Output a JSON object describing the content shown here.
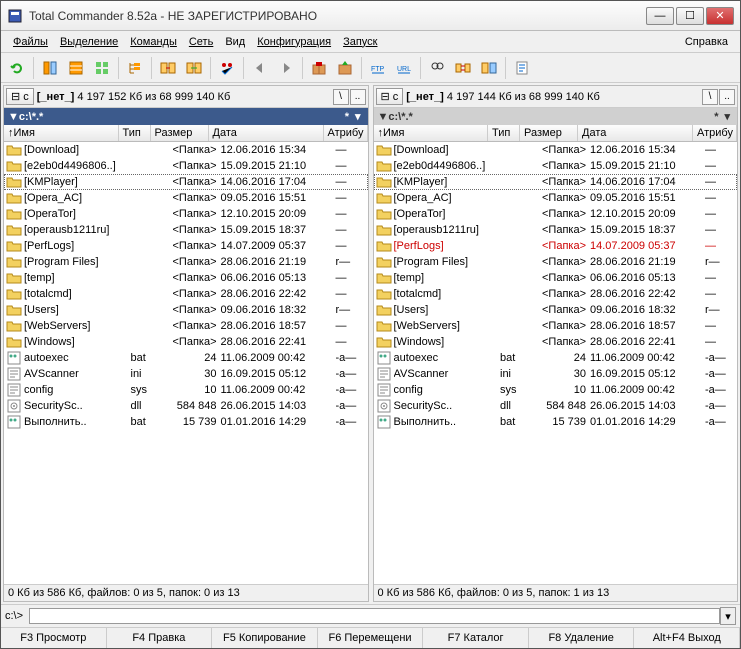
{
  "title": "Total Commander 8.52a - НЕ ЗАРЕГИСТРИРОВАНО",
  "menu": {
    "files": "Файлы",
    "selection": "Выделение",
    "commands": "Команды",
    "net": "Сеть",
    "view": "Вид",
    "config": "Конфигурация",
    "run": "Запуск",
    "help": "Справка"
  },
  "drive": {
    "letter": "c",
    "label": "[_нет_]",
    "left_info": "4 197 152 Кб из 68 999 140 Кб",
    "right_info": "4 197 144 Кб из 68 999 140 Кб"
  },
  "path": {
    "left": "▼c:\\*.*",
    "right": "▼c:\\*.*"
  },
  "columns": {
    "name": "Имя",
    "tip": "Тип",
    "size": "Размер",
    "date": "Дата",
    "attr": "Атрибу"
  },
  "left_files": [
    {
      "n": "[Download]",
      "t": "",
      "s": "<Папка>",
      "d": "12.06.2016 15:34",
      "a": "—",
      "k": "folder"
    },
    {
      "n": "[e2eb0d4496806..]",
      "t": "",
      "s": "<Папка>",
      "d": "15.09.2015 21:10",
      "a": "—",
      "k": "folder"
    },
    {
      "n": "[KMPlayer]",
      "t": "",
      "s": "<Папка>",
      "d": "14.06.2016 17:04",
      "a": "—",
      "k": "folder",
      "sel": true
    },
    {
      "n": "[Opera_AC]",
      "t": "",
      "s": "<Папка>",
      "d": "09.05.2016 15:51",
      "a": "—",
      "k": "folder"
    },
    {
      "n": "[OperaTor]",
      "t": "",
      "s": "<Папка>",
      "d": "12.10.2015 20:09",
      "a": "—",
      "k": "folder"
    },
    {
      "n": "[operausb1211ru]",
      "t": "",
      "s": "<Папка>",
      "d": "15.09.2015 18:37",
      "a": "—",
      "k": "folder"
    },
    {
      "n": "[PerfLogs]",
      "t": "",
      "s": "<Папка>",
      "d": "14.07.2009 05:37",
      "a": "—",
      "k": "folder"
    },
    {
      "n": "[Program Files]",
      "t": "",
      "s": "<Папка>",
      "d": "28.06.2016 21:19",
      "a": "r—",
      "k": "folder"
    },
    {
      "n": "[temp]",
      "t": "",
      "s": "<Папка>",
      "d": "06.06.2016 05:13",
      "a": "—",
      "k": "folder"
    },
    {
      "n": "[totalcmd]",
      "t": "",
      "s": "<Папка>",
      "d": "28.06.2016 22:42",
      "a": "—",
      "k": "folder"
    },
    {
      "n": "[Users]",
      "t": "",
      "s": "<Папка>",
      "d": "09.06.2016 18:32",
      "a": "r—",
      "k": "folder"
    },
    {
      "n": "[WebServers]",
      "t": "",
      "s": "<Папка>",
      "d": "28.06.2016 18:57",
      "a": "—",
      "k": "folder"
    },
    {
      "n": "[Windows]",
      "t": "",
      "s": "<Папка>",
      "d": "28.06.2016 22:41",
      "a": "—",
      "k": "folder"
    },
    {
      "n": "autoexec",
      "t": "bat",
      "s": "24",
      "d": "11.06.2009 00:42",
      "a": "-a—",
      "k": "bat"
    },
    {
      "n": "AVScanner",
      "t": "ini",
      "s": "30",
      "d": "16.09.2015 05:12",
      "a": "-a—",
      "k": "ini"
    },
    {
      "n": "config",
      "t": "sys",
      "s": "10",
      "d": "11.06.2009 00:42",
      "a": "-a—",
      "k": "sys"
    },
    {
      "n": "SecuritySc..",
      "t": "dll",
      "s": "584 848",
      "d": "26.06.2015 14:03",
      "a": "-a—",
      "k": "dll"
    },
    {
      "n": "Выполнить..",
      "t": "bat",
      "s": "15 739",
      "d": "01.01.2016 14:29",
      "a": "-a—",
      "k": "bat"
    }
  ],
  "right_files": [
    {
      "n": "[Download]",
      "t": "",
      "s": "<Папка>",
      "d": "12.06.2016 15:34",
      "a": "—",
      "k": "folder"
    },
    {
      "n": "[e2eb0d4496806..]",
      "t": "",
      "s": "<Папка>",
      "d": "15.09.2015 21:10",
      "a": "—",
      "k": "folder"
    },
    {
      "n": "[KMPlayer]",
      "t": "",
      "s": "<Папка>",
      "d": "14.06.2016 17:04",
      "a": "—",
      "k": "folder",
      "sel": true
    },
    {
      "n": "[Opera_AC]",
      "t": "",
      "s": "<Папка>",
      "d": "09.05.2016 15:51",
      "a": "—",
      "k": "folder"
    },
    {
      "n": "[OperaTor]",
      "t": "",
      "s": "<Папка>",
      "d": "12.10.2015 20:09",
      "a": "—",
      "k": "folder"
    },
    {
      "n": "[operausb1211ru]",
      "t": "",
      "s": "<Папка>",
      "d": "15.09.2015 18:37",
      "a": "—",
      "k": "folder"
    },
    {
      "n": "[PerfLogs]",
      "t": "",
      "s": "<Папка>",
      "d": "14.07.2009 05:37",
      "a": "—",
      "k": "folder",
      "mark": true
    },
    {
      "n": "[Program Files]",
      "t": "",
      "s": "<Папка>",
      "d": "28.06.2016 21:19",
      "a": "r—",
      "k": "folder"
    },
    {
      "n": "[temp]",
      "t": "",
      "s": "<Папка>",
      "d": "06.06.2016 05:13",
      "a": "—",
      "k": "folder"
    },
    {
      "n": "[totalcmd]",
      "t": "",
      "s": "<Папка>",
      "d": "28.06.2016 22:42",
      "a": "—",
      "k": "folder"
    },
    {
      "n": "[Users]",
      "t": "",
      "s": "<Папка>",
      "d": "09.06.2016 18:32",
      "a": "r—",
      "k": "folder"
    },
    {
      "n": "[WebServers]",
      "t": "",
      "s": "<Папка>",
      "d": "28.06.2016 18:57",
      "a": "—",
      "k": "folder"
    },
    {
      "n": "[Windows]",
      "t": "",
      "s": "<Папка>",
      "d": "28.06.2016 22:41",
      "a": "—",
      "k": "folder"
    },
    {
      "n": "autoexec",
      "t": "bat",
      "s": "24",
      "d": "11.06.2009 00:42",
      "a": "-a—",
      "k": "bat"
    },
    {
      "n": "AVScanner",
      "t": "ini",
      "s": "30",
      "d": "16.09.2015 05:12",
      "a": "-a—",
      "k": "ini"
    },
    {
      "n": "config",
      "t": "sys",
      "s": "10",
      "d": "11.06.2009 00:42",
      "a": "-a—",
      "k": "sys"
    },
    {
      "n": "SecuritySc..",
      "t": "dll",
      "s": "584 848",
      "d": "26.06.2015 14:03",
      "a": "-a—",
      "k": "dll"
    },
    {
      "n": "Выполнить..",
      "t": "bat",
      "s": "15 739",
      "d": "01.01.2016 14:29",
      "a": "-a—",
      "k": "bat"
    }
  ],
  "status": {
    "left": "0 Кб из 586 Кб, файлов: 0 из 5, папок: 0 из 13",
    "right": "0 Кб из 586 Кб, файлов: 0 из 5, папок: 1 из 13"
  },
  "cmdprompt": "c:\\>",
  "fkeys": {
    "f3": "F3 Просмотр",
    "f4": "F4 Правка",
    "f5": "F5 Копирование",
    "f6": "F6 Перемещени",
    "f7": "F7 Каталог",
    "f8": "F8 Удаление",
    "altf4": "Alt+F4 Выход"
  },
  "icons": {
    "folder": "<svg width='16' height='14' viewBox='0 0 16 14'><path fill='#f3d160' stroke='#b58a1a' d='M1 3h5l1 2h8v7H1z'/></svg>",
    "bat": "<svg width='16' height='14' viewBox='0 0 16 14'><rect x='2' y='1' width='12' height='12' fill='#fff' stroke='#888'/><circle cx='5' cy='5' r='1.5' fill='#4a8'/><circle cx='9' cy='5' r='1.5' fill='#4a8'/></svg>",
    "ini": "<svg width='16' height='14' viewBox='0 0 16 14'><rect x='2' y='1' width='12' height='12' fill='#fff' stroke='#888'/><path stroke='#888' d='M4 4h8M4 7h8M4 10h5'/></svg>",
    "sys": "<svg width='16' height='14' viewBox='0 0 16 14'><rect x='2' y='1' width='12' height='12' fill='#fff' stroke='#888'/><path stroke='#888' d='M4 4h8M4 7h8M4 10h5'/></svg>",
    "dll": "<svg width='16' height='14' viewBox='0 0 16 14'><rect x='2' y='1' width='12' height='12' fill='#fff' stroke='#888'/><circle cx='8' cy='7' r='3' fill='none' stroke='#888'/><circle cx='8' cy='7' r='1' fill='#888'/></svg>",
    "app": "<svg width='16' height='16' viewBox='0 0 16 16'><rect x='2' y='2' width='12' height='12' fill='#3b5bb5' stroke='#223'/><rect x='4' y='4' width='8' height='3' fill='#fff'/></svg>"
  },
  "tb": [
    "refresh",
    "sep",
    "view-brief",
    "view-full",
    "view-thumbs",
    "sep",
    "tree",
    "sep",
    "swap-panels",
    "same-panel",
    "sep",
    "invert",
    "sep",
    "back",
    "forward",
    "sep",
    "pack",
    "unpack",
    "sep",
    "ftp",
    "url",
    "sep",
    "search",
    "sync",
    "compare",
    "sep",
    "notepad"
  ]
}
